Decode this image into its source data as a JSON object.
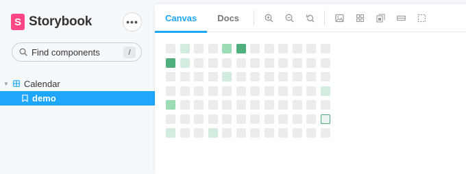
{
  "brand": {
    "mark": "S",
    "name": "Storybook"
  },
  "sidebar": {
    "menu_label": "•••",
    "search": {
      "placeholder": "Find components",
      "shortcut": "/"
    },
    "tree": {
      "group": "Calendar",
      "story": "demo"
    }
  },
  "toolbar": {
    "tabs": [
      {
        "label": "Canvas",
        "active": true
      },
      {
        "label": "Docs",
        "active": false
      }
    ],
    "tools": [
      "zoom-in-icon",
      "zoom-out-icon",
      "zoom-reset-icon",
      "background-icon",
      "grid-icon",
      "viewport-icon",
      "outline-icon",
      "measure-icon"
    ]
  },
  "calendar": {
    "columns": 12,
    "rows": 7,
    "colors": {
      "empty": "#ececec",
      "l1": "#d2ecdd",
      "l2": "#9bdbb6",
      "l3": "#4fb07d"
    },
    "cells": [
      [
        0,
        1,
        0,
        0,
        2,
        3,
        0,
        0,
        0,
        0,
        0,
        0
      ],
      [
        3,
        1,
        0,
        0,
        0,
        0,
        0,
        0,
        0,
        0,
        0,
        0
      ],
      [
        0,
        0,
        0,
        0,
        1,
        0,
        0,
        0,
        0,
        0,
        0,
        0
      ],
      [
        0,
        0,
        0,
        0,
        0,
        0,
        0,
        0,
        0,
        0,
        0,
        1
      ],
      [
        2,
        0,
        0,
        0,
        0,
        0,
        0,
        0,
        0,
        0,
        0,
        0
      ],
      [
        0,
        0,
        0,
        0,
        0,
        0,
        0,
        0,
        0,
        0,
        0,
        "s"
      ],
      [
        1,
        0,
        0,
        1,
        0,
        0,
        0,
        0,
        0,
        0,
        0,
        0
      ]
    ]
  }
}
